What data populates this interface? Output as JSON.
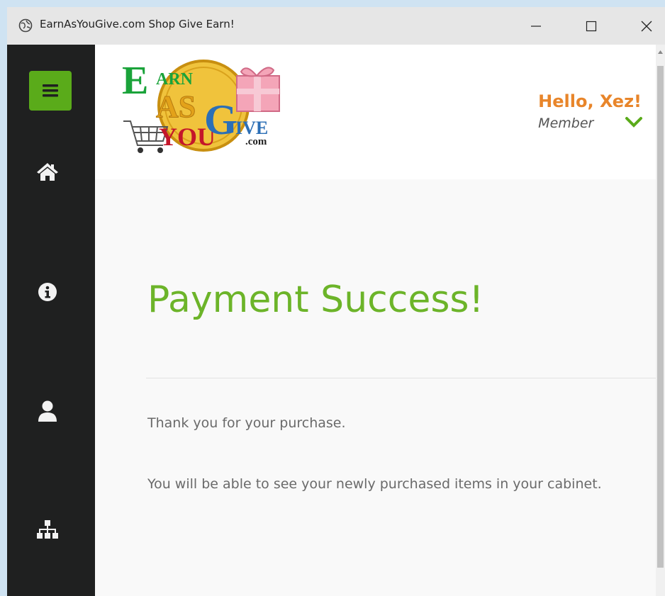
{
  "window": {
    "title": "EarnAsYouGive.com Shop Give Earn!",
    "controls": {
      "minimize": "—",
      "maximize": "☐",
      "close": "✕"
    }
  },
  "sidebar": {
    "menu_icon": "hamburger-icon",
    "items": [
      {
        "icon": "home-icon"
      },
      {
        "icon": "info-icon"
      },
      {
        "icon": "user-icon"
      },
      {
        "icon": "sitemap-icon"
      }
    ]
  },
  "header": {
    "logo": {
      "letters": [
        "E",
        "ARN",
        "AS",
        "YOU",
        "G",
        "IVE",
        ".com"
      ]
    },
    "user": {
      "greeting": "Hello, Xez!",
      "role": "Member",
      "dropdown_icon": "chevron-down-icon"
    }
  },
  "content": {
    "title": "Payment Success!",
    "messages": [
      "Thank you for your purchase.",
      "You will be able to see your newly purchased items in your cabinet."
    ]
  },
  "colors": {
    "accent_green": "#6cb429",
    "menu_green": "#5aab1a",
    "greeting_orange": "#e8852a",
    "sidebar_bg": "#1f2020"
  }
}
